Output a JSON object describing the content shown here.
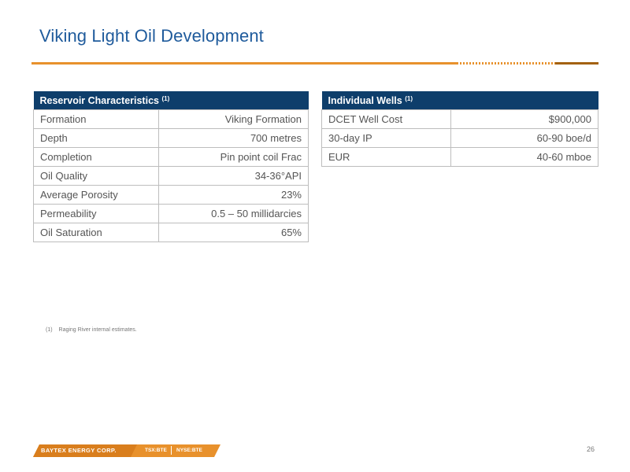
{
  "slide": {
    "title": "Viking Light Oil Development",
    "page_number": "26"
  },
  "reservoir": {
    "header": "Reservoir Characteristics",
    "header_note": "(1)",
    "rows": [
      {
        "label": "Formation",
        "value": "Viking Formation"
      },
      {
        "label": "Depth",
        "value": "700 metres"
      },
      {
        "label": "Completion",
        "value": "Pin point coil Frac"
      },
      {
        "label": "Oil Quality",
        "value": "34-36°API"
      },
      {
        "label": "Average Porosity",
        "value": "23%"
      },
      {
        "label": "Permeability",
        "value": "0.5 – 50 millidarcies"
      },
      {
        "label": "Oil Saturation",
        "value": "65%"
      }
    ]
  },
  "wells": {
    "header": "Individual Wells",
    "header_note": "(1)",
    "rows": [
      {
        "label": "DCET Well Cost",
        "value": "$900,000"
      },
      {
        "label": "30-day IP",
        "value": "60-90 boe/d"
      },
      {
        "label": "EUR",
        "value": "40-60 mboe"
      }
    ]
  },
  "footnote": {
    "number": "(1)",
    "text": "Raging River internal estimates."
  },
  "footer": {
    "brand": "BAYTEX ENERGY CORP.",
    "ticker_tsx": "TSX:BTE",
    "ticker_nyse": "NYSE:BTE"
  },
  "colors": {
    "title": "#1f5b9c",
    "header_bg": "#0e3e6b",
    "accent": "#e8912c"
  }
}
